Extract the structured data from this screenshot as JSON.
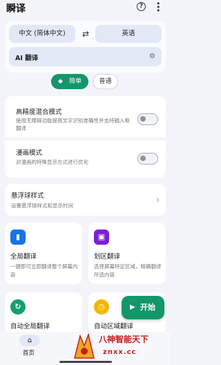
{
  "app": {
    "title": "瞬译",
    "help_icon": "?",
    "more_icon": "⋮"
  },
  "language": {
    "source": "中文 (简体中文)",
    "target": "英语",
    "swap_icon": "⇄"
  },
  "engine": {
    "label": "AI 翻译",
    "settings_icon": "⚙"
  },
  "modes": {
    "simple": "简单",
    "normal": "普通",
    "selected": "简单"
  },
  "options": [
    {
      "title": "高精度混合模式",
      "desc": "使用无障碍功能提高文字识别准确性并支持输入框翻译",
      "enabled": false
    },
    {
      "title": "漫画模式",
      "desc": "对漫画的特殊显示方式进行优化",
      "enabled": false
    }
  ],
  "floating_ball": {
    "title": "悬浮球样式",
    "desc": "设置悬浮球样式和显示时间",
    "chevron": "›"
  },
  "features": [
    {
      "title": "全局翻译",
      "desc": "一键即可立即翻译整个屏幕内容",
      "icon_color": "#1a73e8",
      "icon_glyph": "▮"
    },
    {
      "title": "划区翻译",
      "desc": "选择屏幕特定区域，精确翻译所选内容",
      "icon_color": "#7b1fd6",
      "icon_glyph": "▣"
    },
    {
      "title": "自动全局翻译",
      "desc": "",
      "icon_color": "#14a06d",
      "icon_glyph": "↻"
    },
    {
      "title": "自动区域翻译",
      "desc": "",
      "icon_color": "#f2b705",
      "icon_glyph": "◷"
    }
  ],
  "fab": {
    "label": "开始",
    "icon": "▶"
  },
  "nav": {
    "home_label": "首页",
    "home_icon": "⌂"
  },
  "watermark": {
    "text": "八神智能天下",
    "domain": "znxx.cc"
  }
}
